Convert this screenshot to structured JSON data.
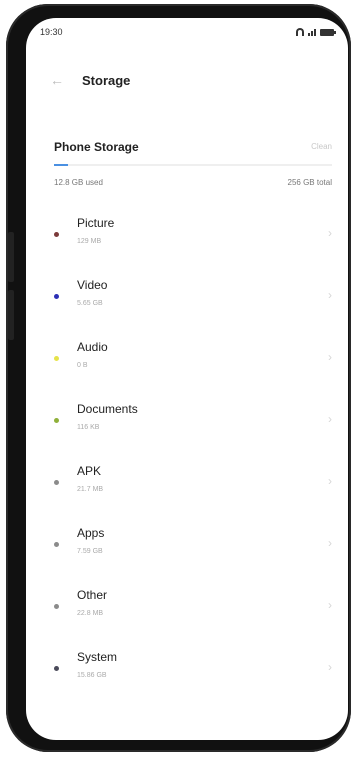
{
  "status_bar": {
    "time": "19:30"
  },
  "header": {
    "title": "Storage"
  },
  "storage": {
    "section_title": "Phone Storage",
    "action_label": "Clean",
    "used_label": "12.8 GB used",
    "total_label": "256 GB total",
    "usage_fraction": 0.05,
    "accent": "#4a90e2"
  },
  "items": [
    {
      "label": "Picture",
      "size": "129 MB",
      "color": "#7b3a3a"
    },
    {
      "label": "Video",
      "size": "5.65 GB",
      "color": "#2c2fb5"
    },
    {
      "label": "Audio",
      "size": "0 B",
      "color": "#e6e34a"
    },
    {
      "label": "Documents",
      "size": "116 KB",
      "color": "#8fb03a"
    },
    {
      "label": "APK",
      "size": "21.7 MB",
      "color": "#8b8b8b"
    },
    {
      "label": "Apps",
      "size": "7.59 GB",
      "color": "#8b8b8b"
    },
    {
      "label": "Other",
      "size": "22.8 MB",
      "color": "#8b8b8b"
    },
    {
      "label": "System",
      "size": "15.86 GB",
      "color": "#4b4b5a"
    }
  ]
}
